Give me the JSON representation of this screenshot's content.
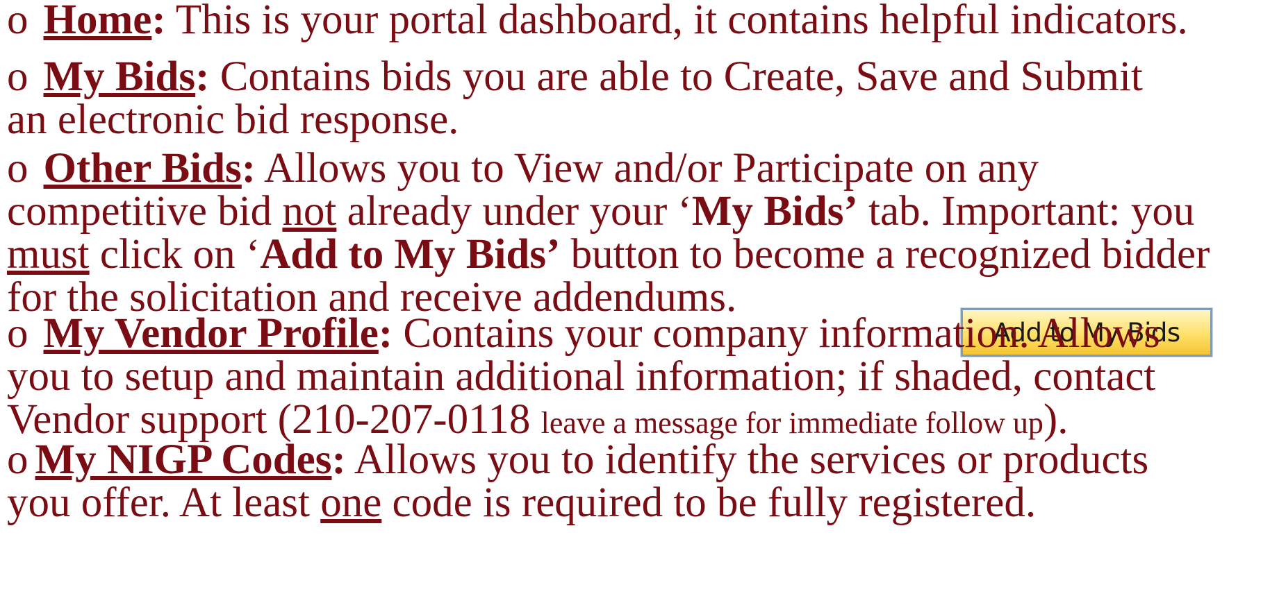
{
  "items": [
    {
      "bullet": "o",
      "term": "Home",
      "colon": ":",
      "line1": " This is your portal dashboard, it contains helpful indicators."
    },
    {
      "bullet": "o",
      "term": "My Bids",
      "colon": ":",
      "line1": "  Contains bids you are able to Create, Save and Submit",
      "line2": "an electronic bid response."
    },
    {
      "bullet": "o",
      "term": "Other Bids",
      "colon": ":",
      "line1": "  Allows you to View and/or Participate on any",
      "line2_a": "competitive bid ",
      "line2_u": "not",
      "line2_b": " already under your ‘",
      "line2_bold": "My Bids’",
      "line2_c": " tab.  Important: you",
      "line3_u": "must",
      "line3_a": " click on ‘",
      "line3_bold": "Add to My Bids’",
      "line3_b": " button to become a recognized bidder",
      "line4": "for the solicitation and receive addendums."
    },
    {
      "bullet": "o",
      "term": "My Vendor Profile",
      "colon": ":",
      "line1": " Contains your company information. Allows",
      "line2": "you to setup and maintain additional information; if shaded, contact",
      "line3_a": "Vendor support (210-207-0118 ",
      "line3_small": "leave a message for immediate follow up",
      "line3_b": ")."
    },
    {
      "bullet": "o",
      "term": "My NIGP Codes",
      "colon": ":",
      "line1": "  Allows you to identify the services or products",
      "line2_a": "you offer.  At least ",
      "line2_u": "one",
      "line2_b": " code is required to be fully registered."
    }
  ],
  "add_button": {
    "label": "Add to My Bids"
  }
}
